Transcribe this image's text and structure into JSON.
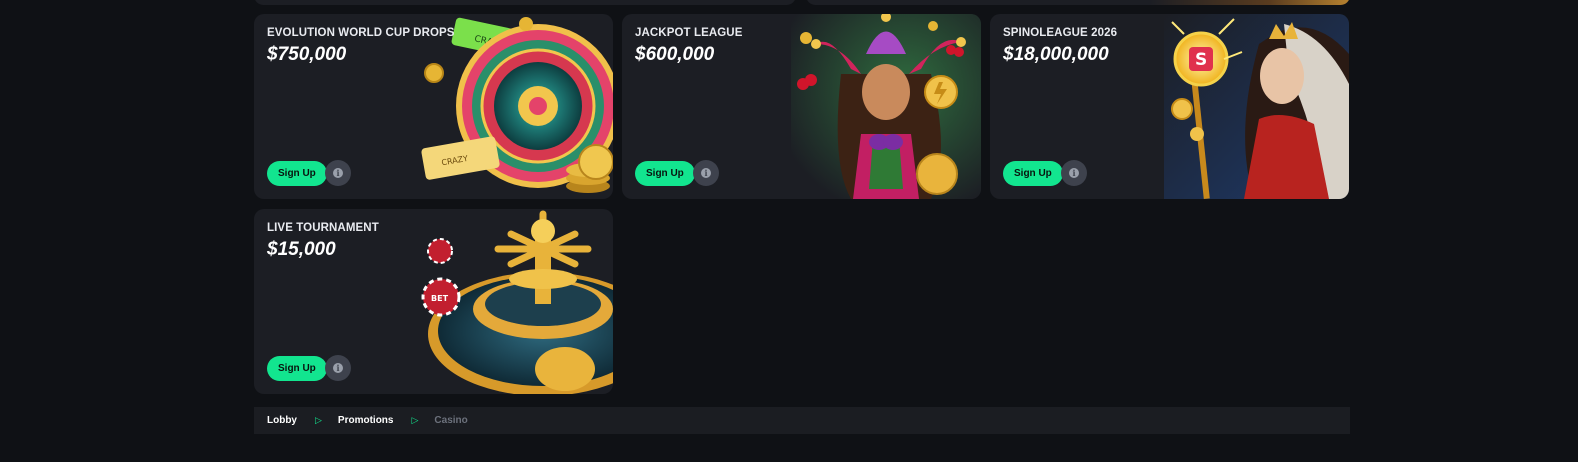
{
  "cards": [
    {
      "title": "EVOLUTION WORLD CUP DROPS",
      "amount": "$750,000",
      "signup_label": "Sign Up",
      "art_icon": "roulette-wheel-icon"
    },
    {
      "title": "JACKPOT LEAGUE",
      "amount": "$600,000",
      "signup_label": "Sign Up",
      "art_icon": "jester-girl-icon"
    },
    {
      "title": "SPINOLEAGUE 2026",
      "amount": "$18,000,000",
      "signup_label": "Sign Up",
      "art_icon": "sorceress-staff-icon"
    },
    {
      "title": "LIVE TOURNAMENT",
      "amount": "$15,000",
      "signup_label": "Sign Up",
      "art_icon": "golden-roulette-icon"
    }
  ],
  "info_glyph": "i",
  "breadcrumb": {
    "items": [
      "Lobby",
      "Promotions",
      "Casino"
    ],
    "separator": "▷"
  },
  "colors": {
    "background": "#0f1115",
    "card": "#1c1e24",
    "accent": "#12e58f",
    "info_button": "#3e424d"
  }
}
